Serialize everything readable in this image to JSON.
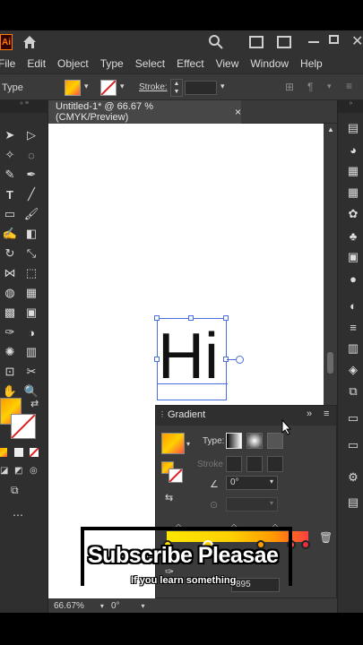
{
  "app": {
    "logo": "Ai",
    "menu": [
      "File",
      "Edit",
      "Object",
      "Type",
      "Select",
      "Effect",
      "View",
      "Window",
      "Help"
    ]
  },
  "control_bar": {
    "selection_label": "Type",
    "stroke_label": "Stroke:"
  },
  "document": {
    "tab_title": "Untitled-1* @ 66.67 % (CMYK/Preview)",
    "close_symbol": "×"
  },
  "canvas": {
    "text": "Hi"
  },
  "gradient_panel": {
    "title": "Gradient",
    "type_label": "Type:",
    "stroke_label": "Stroke",
    "angle_value": "0°",
    "opacity_value": "895"
  },
  "status_bar": {
    "zoom": "66.67%",
    "rotation": "0°"
  },
  "overlay": {
    "headline": "Subscribe Pleasae",
    "subline": "If you learn something"
  },
  "colors": {
    "gradient_start": "#ff9a00",
    "gradient_mid": "#ffd000",
    "gradient_end": "#ff4f3f",
    "ui_dark": "#323232",
    "overlay_text": "#ffffff"
  }
}
